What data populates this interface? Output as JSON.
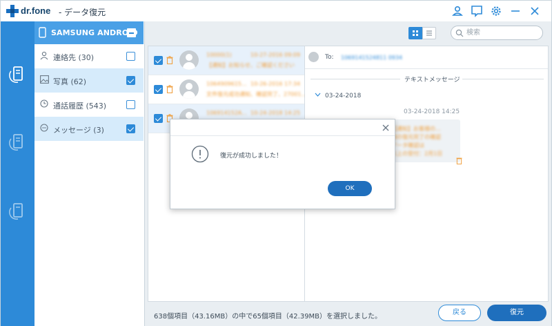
{
  "app": {
    "logo": "dr.fone",
    "subtitle": "- データ復元"
  },
  "sidebar": {
    "device_name": "SAMSUNG ANDROID",
    "categories": [
      {
        "label": "連絡先 (30)",
        "checked": false,
        "icon": "contact-icon"
      },
      {
        "label": "写真 (62)",
        "checked": true,
        "icon": "photo-icon"
      },
      {
        "label": "通話履歴 (543)",
        "checked": false,
        "icon": "call-history-icon"
      },
      {
        "label": "メッセージ (3)",
        "checked": true,
        "icon": "message-icon"
      }
    ]
  },
  "search": {
    "placeholder": "検索"
  },
  "messages": [
    {
      "sender": "10000(1)",
      "time": "10-27-2016 09:09",
      "snippet": "【通知】お知らせ、ご確認ください",
      "checked": true
    },
    {
      "sender": "1064909615...",
      "time": "10-26-2016 17:34",
      "snippet": "文件復元成功通知、確認完了、27001...",
      "checked": true
    },
    {
      "sender": "106914152A...",
      "time": "10-24-2018 14:25",
      "snippet": "",
      "checked": true
    }
  ],
  "detail": {
    "to_label": "To:",
    "to_number": "1069141524811 0934",
    "section_title": "テキストメッセージ",
    "date_group": "03-24-2018",
    "timestamp": "03-24-2018 14:25",
    "bubble_lines": [
      "【通知】お客様の...",
      "様の復元完了の確認",
      "データ確認は",
      "以上の受付：2月1日"
    ]
  },
  "footer": {
    "summary": "638個項目（43.16MB）の中で65個項目（42.39MB）を選択しました。",
    "back_label": "戻る",
    "restore_label": "復元"
  },
  "modal": {
    "message": "復元が成功しました！",
    "ok_label": "OK"
  },
  "colors": {
    "primary": "#2d8ad8",
    "header_blue": "#4aa0e6",
    "button_dark": "#1f6fbd",
    "highlight": "#d6ebfb",
    "orange": "#f0a040"
  }
}
